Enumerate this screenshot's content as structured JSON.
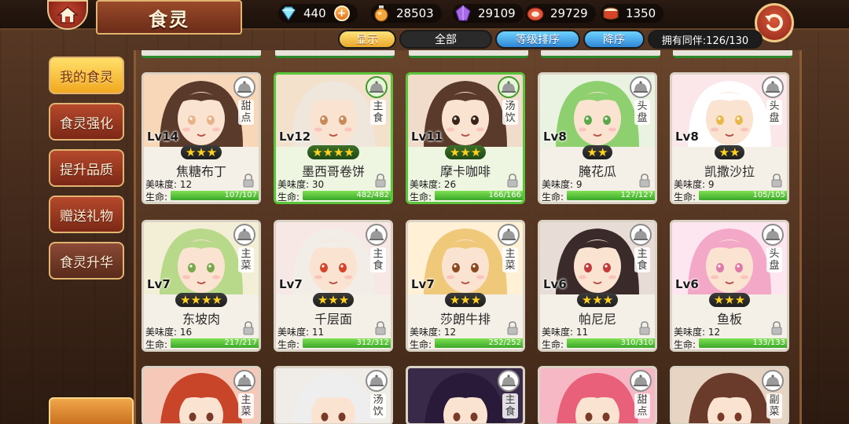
{
  "header": {
    "title": "食灵",
    "resources": [
      {
        "icon": "diamond-icon",
        "value": "440"
      },
      {
        "icon": "potion-icon",
        "value": "28503"
      },
      {
        "icon": "crystal-icon",
        "value": "29109"
      },
      {
        "icon": "meat-icon",
        "value": "29729"
      },
      {
        "icon": "drum-icon",
        "value": "1350"
      }
    ]
  },
  "filters": {
    "show": "显示",
    "all": "全部",
    "sort": "等级排序",
    "desc": "降序",
    "owned": "拥有同伴:126/130"
  },
  "sidebar": {
    "items": [
      {
        "label": "我的食灵",
        "active": true
      },
      {
        "label": "食灵强化",
        "active": false
      },
      {
        "label": "提升品质",
        "active": false
      },
      {
        "label": "赠送礼物",
        "active": false
      },
      {
        "label": "食灵升华",
        "active": false
      }
    ]
  },
  "stat_labels": {
    "taste": "美味度:",
    "hp": "生命:"
  },
  "cards": [
    {
      "lv": "Lv14",
      "stars": "★★★",
      "name": "焦糖布丁",
      "type": "甜点",
      "taste": "12",
      "hp": "107/107",
      "hp_ratio": 1,
      "highlight": false
    },
    {
      "lv": "Lv12",
      "stars": "★★★★",
      "name": "墨西哥卷饼",
      "type": "主食",
      "taste": "30",
      "hp": "482/482",
      "hp_ratio": 1,
      "highlight": true
    },
    {
      "lv": "Lv11",
      "stars": "★★★",
      "name": "摩卡咖啡",
      "type": "汤饮",
      "taste": "26",
      "hp": "166/166",
      "hp_ratio": 1,
      "highlight": true
    },
    {
      "lv": "Lv8",
      "stars": "★★",
      "name": "腌花瓜",
      "type": "头盘",
      "taste": "9",
      "hp": "127/127",
      "hp_ratio": 1,
      "highlight": false
    },
    {
      "lv": "Lv8",
      "stars": "★★",
      "name": "凯撒沙拉",
      "type": "头盘",
      "taste": "9",
      "hp": "105/105",
      "hp_ratio": 1,
      "highlight": false
    },
    {
      "lv": "Lv7",
      "stars": "★★★★",
      "name": "东坡肉",
      "type": "主菜",
      "taste": "16",
      "hp": "217/217",
      "hp_ratio": 1,
      "highlight": false
    },
    {
      "lv": "Lv7",
      "stars": "★★★",
      "name": "千层面",
      "type": "主食",
      "taste": "11",
      "hp": "312/312",
      "hp_ratio": 1,
      "highlight": false
    },
    {
      "lv": "Lv7",
      "stars": "★★★",
      "name": "莎朗牛排",
      "type": "主菜",
      "taste": "12",
      "hp": "252/252",
      "hp_ratio": 1,
      "highlight": false
    },
    {
      "lv": "Lv6",
      "stars": "★★★",
      "name": "帕尼尼",
      "type": "主食",
      "taste": "11",
      "hp": "310/310",
      "hp_ratio": 1,
      "highlight": false
    },
    {
      "lv": "Lv6",
      "stars": "★★★",
      "name": "鱼板",
      "type": "头盘",
      "taste": "12",
      "hp": "133/133",
      "hp_ratio": 1,
      "highlight": false
    }
  ],
  "bottom_cards": [
    {
      "type": "主菜"
    },
    {
      "type": "汤饮"
    },
    {
      "type": "主食"
    },
    {
      "type": "甜点"
    },
    {
      "type": "副菜"
    }
  ],
  "colors": {
    "accent_green": "#5ac53a",
    "hp_green": "#3aa82a",
    "star_gold": "#ffd21f",
    "menu_red": "#b5492c",
    "menu_active": "#f2a820"
  }
}
